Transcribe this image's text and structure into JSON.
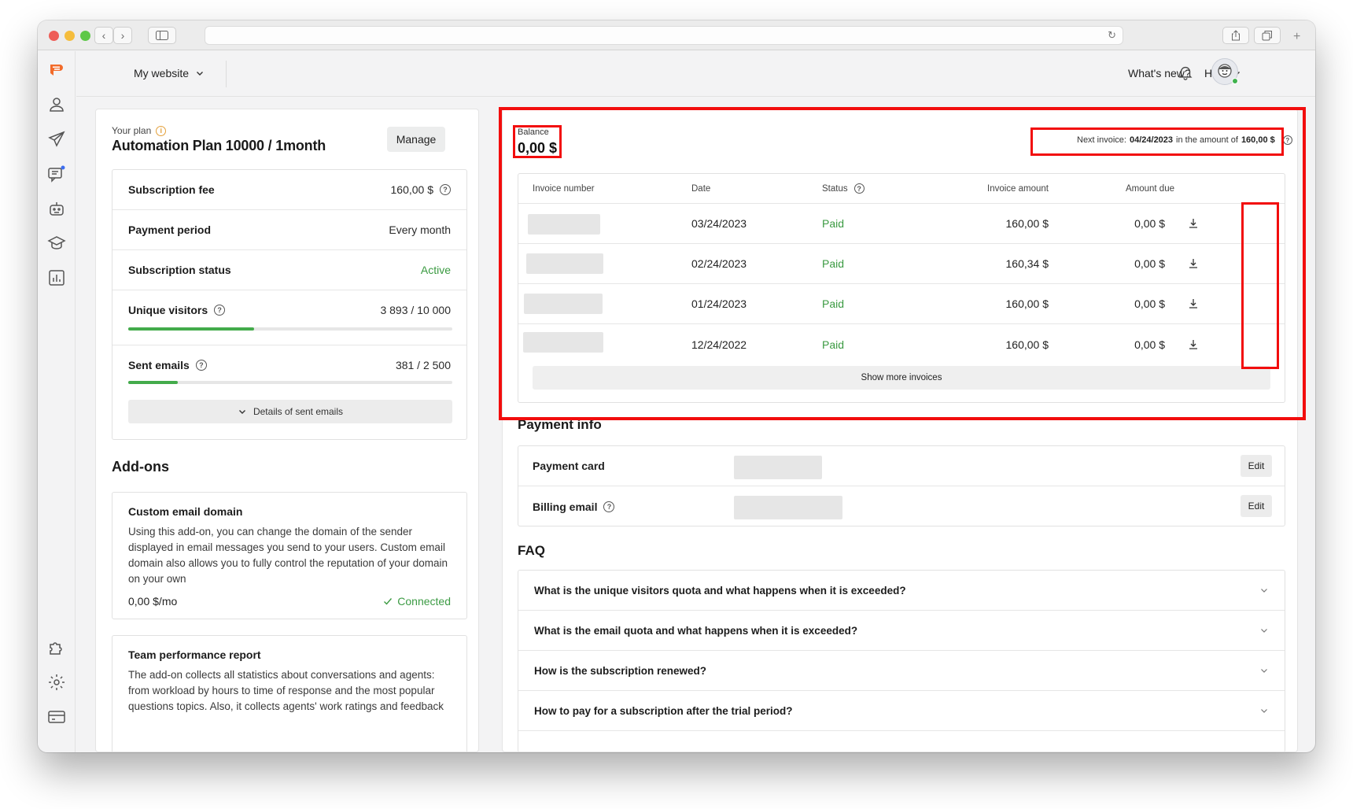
{
  "browser": {
    "url": "",
    "icons": [
      "back-icon",
      "forward-icon",
      "sidebar-icon",
      "reload-icon",
      "share-icon",
      "tabs-icon",
      "new-tab-icon"
    ]
  },
  "header": {
    "site_selector": "My website",
    "whats_new": "What's new?",
    "help": "Help"
  },
  "rail": {
    "icons": [
      "logo-icon",
      "visitors-icon",
      "campaigns-icon",
      "chats-icon",
      "chatbot-icon",
      "academy-icon",
      "reports-icon",
      "integrations-icon",
      "settings-icon",
      "billing-icon"
    ]
  },
  "plan": {
    "label": "Your plan",
    "name": "Automation Plan 10000 / 1month",
    "manage_button": "Manage",
    "rows": {
      "fee_label": "Subscription fee",
      "fee_value": "160,00 $",
      "period_label": "Payment period",
      "period_value": "Every month",
      "status_label": "Subscription status",
      "status_value": "Active",
      "visitors_label": "Unique visitors",
      "visitors_value": "3 893 / 10 000",
      "visitors_progress": 0.389,
      "emails_label": "Sent emails",
      "emails_value": "381 / 2 500",
      "emails_progress": 0.152
    },
    "details_button": "Details of sent emails"
  },
  "addons": {
    "title": "Add-ons",
    "items": [
      {
        "title": "Custom email domain",
        "description": "Using this add-on, you can change the domain of the sender displayed in email messages you send to your users. Custom email domain also allows you to fully control the reputation of your domain on your own",
        "price": "0,00 $/mo",
        "status": "Connected"
      },
      {
        "title": "Team performance report",
        "description": "The add-on collects all statistics about conversations and agents: from workload by hours to time of response and the most popular questions topics. Also, it collects agents' work ratings and feedback"
      }
    ]
  },
  "billing": {
    "balance_label": "Balance",
    "balance_value": "0,00 $",
    "next_invoice": {
      "prefix": "Next invoice:",
      "date": "04/24/2023",
      "middle": "in the amount of",
      "amount": "160,00 $"
    },
    "table": {
      "headers": {
        "number": "Invoice number",
        "date": "Date",
        "status": "Status",
        "amount": "Invoice amount",
        "due": "Amount due"
      },
      "rows": [
        {
          "date": "03/24/2023",
          "status": "Paid",
          "amount": "160,00 $",
          "due": "0,00 $"
        },
        {
          "date": "02/24/2023",
          "status": "Paid",
          "amount": "160,34 $",
          "due": "0,00 $"
        },
        {
          "date": "01/24/2023",
          "status": "Paid",
          "amount": "160,00 $",
          "due": "0,00 $"
        },
        {
          "date": "12/24/2022",
          "status": "Paid",
          "amount": "160,00 $",
          "due": "0,00 $"
        }
      ],
      "show_more": "Show more invoices"
    }
  },
  "payment_info": {
    "title": "Payment info",
    "card_label": "Payment card",
    "email_label": "Billing email",
    "edit_label": "Edit"
  },
  "faq": {
    "title": "FAQ",
    "items": [
      "What is the unique visitors quota and what happens when it is exceeded?",
      "What is the email quota and what happens when it is exceeded?",
      "How is the subscription renewed?",
      "How to pay for a subscription after the trial period?"
    ]
  },
  "colors": {
    "accent_orange": "#f26b2a",
    "success_green": "#3a9a41",
    "highlight_red": "#f20d0d"
  }
}
